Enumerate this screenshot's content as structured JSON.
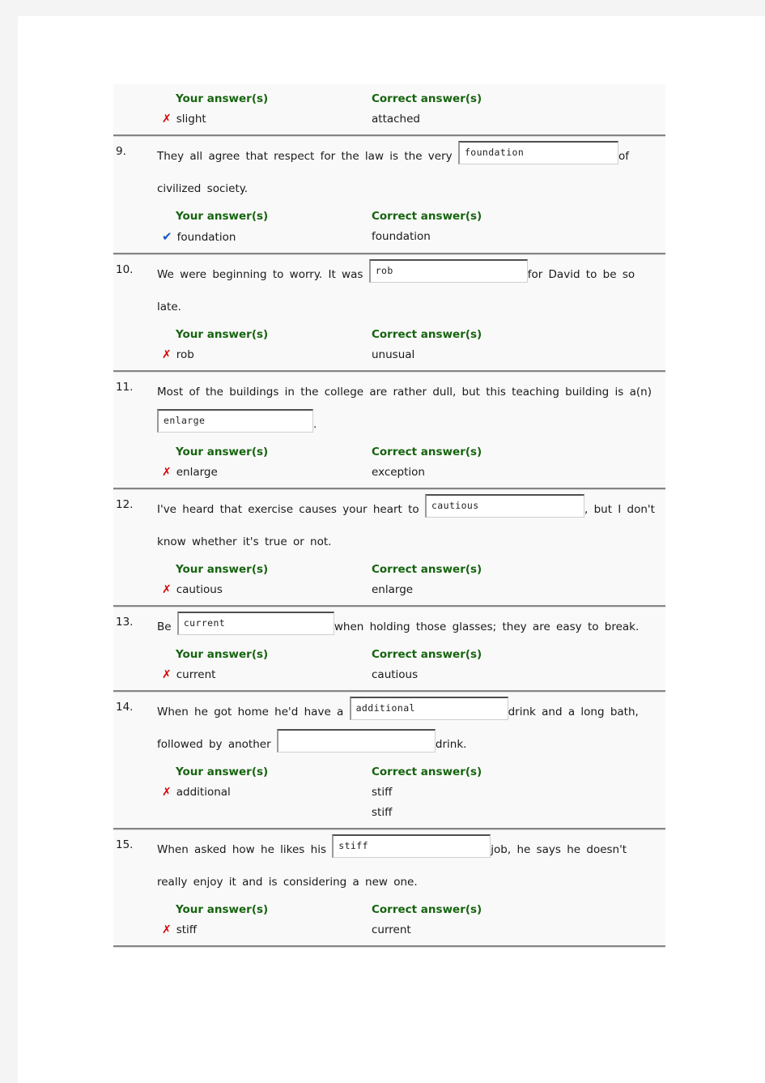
{
  "labels": {
    "your_answers": "Your answer(s)",
    "correct_answers": "Correct answer(s)",
    "wrong_mark": "✗",
    "right_mark": "✔"
  },
  "colors": {
    "header_green": "#16640f",
    "wrong_red": "#d40000",
    "right_blue": "#1757c8",
    "block_background": "#f9f9f9",
    "page_background": "#ffffff",
    "outer_background": "#f4f4f5",
    "divider": "#858585"
  },
  "partial_first_block": {
    "your_answers_label": "Your answer(s)",
    "correct_answers_label": "Correct answer(s)",
    "your_answer": "slight",
    "correct_answer": "attached",
    "is_correct": false
  },
  "questions": [
    {
      "number": "9.",
      "segments": [
        {
          "type": "text",
          "value": "They all agree that respect for the law is the very "
        },
        {
          "type": "input",
          "value": "foundation",
          "width": "w198"
        },
        {
          "type": "text",
          "value": "of civilized society."
        }
      ],
      "your_answers_label": "Your answer(s)",
      "correct_answers_label": "Correct answer(s)",
      "your_answer": "foundation",
      "correct_answers": [
        "foundation"
      ],
      "is_correct": true
    },
    {
      "number": "10.",
      "segments": [
        {
          "type": "text",
          "value": "We were beginning to worry. It was "
        },
        {
          "type": "input",
          "value": "rob",
          "width": "w196"
        },
        {
          "type": "text",
          "value": "for David to be so late."
        }
      ],
      "your_answers_label": "Your answer(s)",
      "correct_answers_label": "Correct answer(s)",
      "your_answer": "rob",
      "correct_answers": [
        "unusual"
      ],
      "is_correct": false
    },
    {
      "number": "11.",
      "segments": [
        {
          "type": "text",
          "value": "Most of the buildings in the college are rather dull, but this teaching building is a(n) "
        },
        {
          "type": "input",
          "value": "enlarge",
          "width": "w193"
        },
        {
          "type": "text",
          "value": "."
        }
      ],
      "your_answers_label": "Your answer(s)",
      "correct_answers_label": "Correct answer(s)",
      "your_answer": "enlarge",
      "correct_answers": [
        "exception"
      ],
      "is_correct": false
    },
    {
      "number": "12.",
      "segments": [
        {
          "type": "text",
          "value": "I've heard that exercise causes your heart to "
        },
        {
          "type": "input",
          "value": "cautious",
          "width": "w197"
        },
        {
          "type": "text",
          "value": ", but I don't know whether it's true or not."
        }
      ],
      "your_answers_label": "Your answer(s)",
      "correct_answers_label": "Correct answer(s)",
      "your_answer": "cautious",
      "correct_answers": [
        "enlarge"
      ],
      "is_correct": false
    },
    {
      "number": "13.",
      "segments": [
        {
          "type": "text",
          "value": "Be "
        },
        {
          "type": "input",
          "value": "current",
          "width": "w194"
        },
        {
          "type": "text",
          "value": "when holding those glasses; they are easy to break."
        }
      ],
      "your_answers_label": "Your answer(s)",
      "correct_answers_label": "Correct answer(s)",
      "your_answer": "current",
      "correct_answers": [
        "cautious"
      ],
      "is_correct": false
    },
    {
      "number": "14.",
      "segments": [
        {
          "type": "text",
          "value": "When he got home he'd have a "
        },
        {
          "type": "input",
          "value": "additional",
          "width": "w196"
        },
        {
          "type": "text",
          "value": "drink and a long bath, followed by another "
        },
        {
          "type": "input",
          "value": "",
          "width": "w196"
        },
        {
          "type": "text",
          "value": "drink."
        }
      ],
      "your_answers_label": "Your answer(s)",
      "correct_answers_label": "Correct answer(s)",
      "your_answer": "additional",
      "correct_answers": [
        "stiff",
        "stiff"
      ],
      "is_correct": false
    },
    {
      "number": "15.",
      "segments": [
        {
          "type": "text",
          "value": "When asked how he likes his "
        },
        {
          "type": "input",
          "value": "stiff",
          "width": "w196"
        },
        {
          "type": "text",
          "value": "job, he says he doesn't really enjoy it and is considering a new one."
        }
      ],
      "your_answers_label": "Your answer(s)",
      "correct_answers_label": "Correct answer(s)",
      "your_answer": "stiff",
      "correct_answers": [
        "current"
      ],
      "is_correct": false
    }
  ]
}
